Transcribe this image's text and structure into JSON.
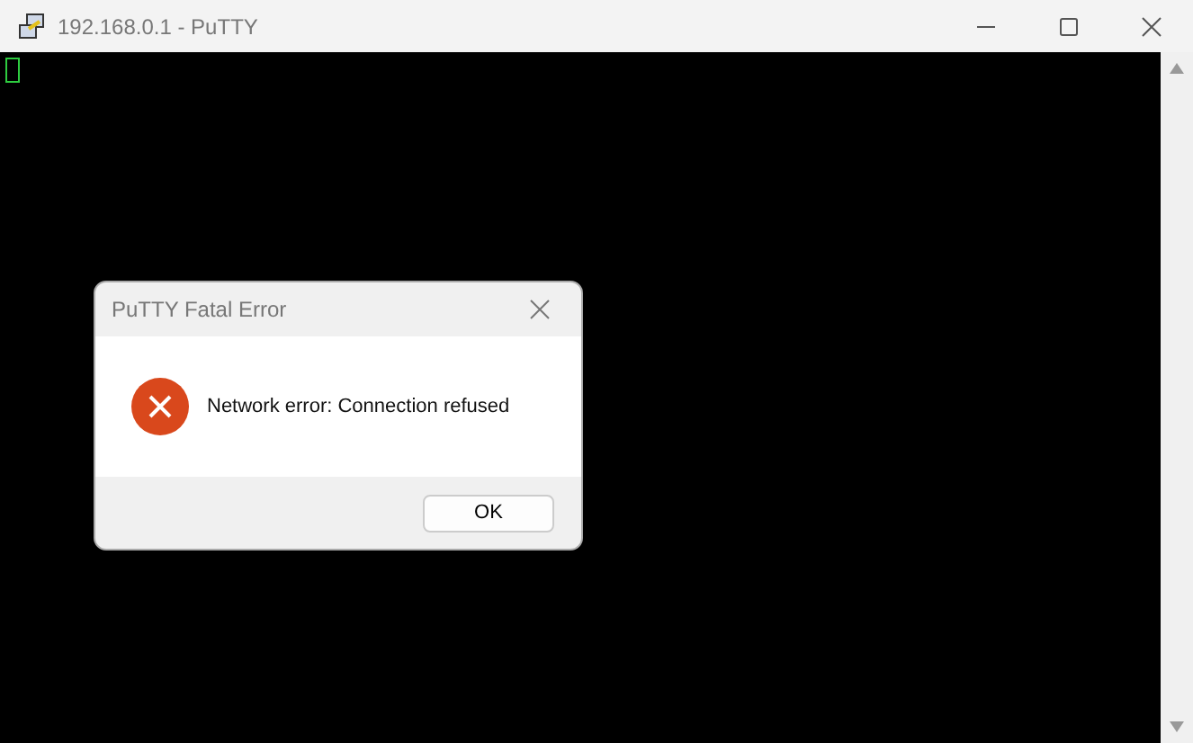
{
  "window": {
    "title": "192.168.0.1 - PuTTY"
  },
  "terminal": {
    "cursor_visible": true
  },
  "dialog": {
    "title": "PuTTY Fatal Error",
    "message": "Network error: Connection refused",
    "buttons": [
      "OK"
    ]
  }
}
